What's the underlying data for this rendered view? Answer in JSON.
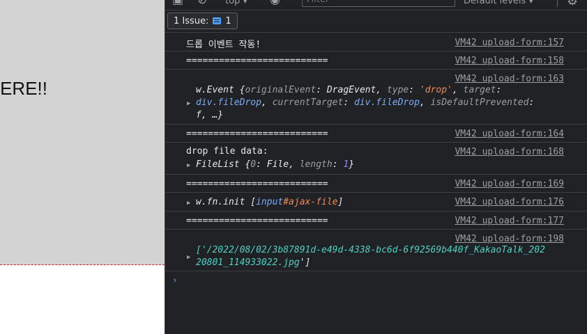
{
  "page": {
    "drop_text": "ERE!!"
  },
  "toolbar": {
    "context": "top ▾",
    "filter_placeholder": "Filter",
    "levels": "Default levels ▾"
  },
  "issues": {
    "label": "1 Issue:",
    "count": "1"
  },
  "messages": [
    {
      "text": "드롭 이벤트 작동!",
      "source": "VM42 upload-form:157"
    },
    {
      "text": "==========================",
      "source": "VM42 upload-form:158"
    },
    {
      "source": "VM42 upload-form:163",
      "obj": {
        "l1": {
          "a": "w.Event {",
          "b": "originalEvent",
          "c": ": DragEvent, ",
          "d": "type",
          "e": ": ",
          "f": "'drop'",
          "g": ", ",
          "h": "target",
          "i": ":"
        },
        "l2": {
          "a": "div.fileDrop",
          "b": ", ",
          "c": "currentTarget",
          "d": ": ",
          "e": "div.fileDrop",
          "f": ", ",
          "g": "isDefaultPrevented",
          "h": ":"
        },
        "l3": "f, …}"
      }
    },
    {
      "text": "==========================",
      "source": "VM42 upload-form:164"
    },
    {
      "text": "drop file data:",
      "source": "VM42 upload-form:168",
      "obj": {
        "a": "FileList {",
        "b": "0",
        "c": ": File, ",
        "d": "length",
        "e": ": ",
        "f": "1",
        "g": "}"
      }
    },
    {
      "text": "==========================",
      "source": "VM42 upload-form:169"
    },
    {
      "source": "VM42 upload-form:176",
      "obj": {
        "a": "w.fn.init [",
        "b": "input",
        "c": "#ajax-file",
        "d": "]"
      }
    },
    {
      "text": "==========================",
      "source": "VM42 upload-form:177"
    },
    {
      "source": "VM42 upload-form:198",
      "obj": {
        "l1": "['/2022/08/02/3b87891d-e49d-4338-bc6d-6f92569b440f_KakaoTalk_202",
        "l2": "20801_114933022.jpg",
        "l3": "']"
      }
    }
  ],
  "prompt": "›",
  "icons": {
    "toolbar_1": "sidebar-icon",
    "toolbar_2": "clear-console-icon",
    "toolbar_3": "eye-icon",
    "settings": "gear-icon",
    "issues": "message-icon",
    "expand": "triangle-right-icon"
  },
  "colors": {
    "background": "#202124",
    "text": "#e8eaed",
    "key": "#9aa0a6",
    "string": "#f28b54",
    "number": "#9980ff",
    "element": "#7cacf8",
    "path": "#4ed1c4",
    "accent": "#4da0ff"
  }
}
